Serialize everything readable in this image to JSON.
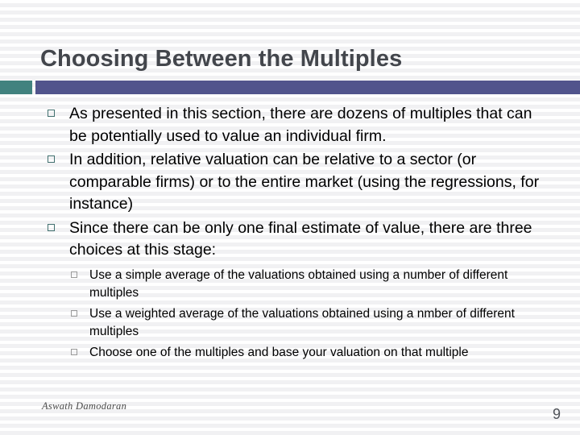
{
  "slide": {
    "title": "Choosing Between the Multiples",
    "accent_teal": "#41827f",
    "accent_purple": "#51548c",
    "title_color": "#43464c",
    "bullets": [
      {
        "text": "As presented in this section, there are dozens of multiples that can be potentially used to value an individual firm.",
        "marker": "hollow-square-teal"
      },
      {
        "text": "In addition, relative valuation can be relative to a sector (or comparable firms) or to the entire market (using the regressions, for instance)",
        "marker": "hollow-square-teal"
      },
      {
        "text": "Since there can be only one final estimate of value, there are three choices at this stage:",
        "marker": "hollow-square-teal"
      }
    ],
    "sub_bullets": [
      {
        "text": "Use a simple average of the valuations obtained using a number of different multiples",
        "marker": "hollow-square-gray"
      },
      {
        "text": "Use a weighted average of the valuations obtained using a nmber of different multiples",
        "marker": "hollow-square-gray"
      },
      {
        "text": "Choose one of the multiples and base your valuation on that multiple",
        "marker": "hollow-square-gray"
      }
    ],
    "footer": {
      "author": "Aswath Damodaran",
      "page_number": "9"
    }
  }
}
